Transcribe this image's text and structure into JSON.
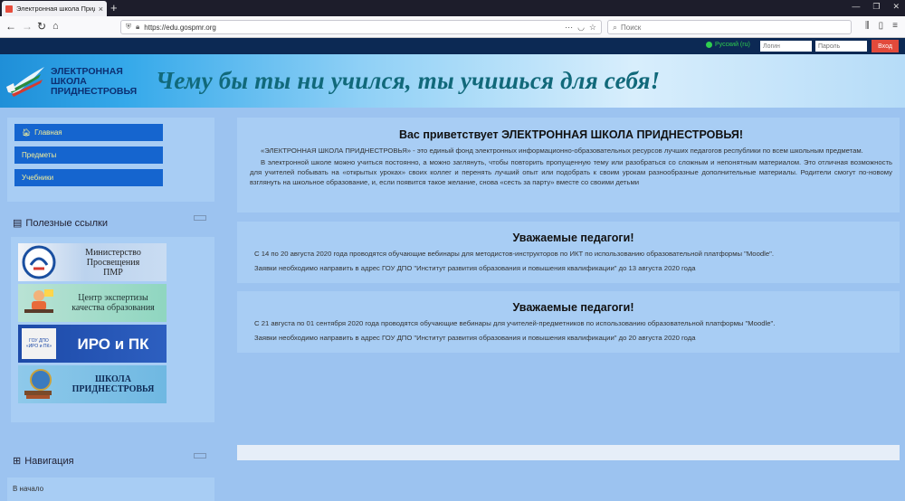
{
  "browser": {
    "tab_title": "Электронная школа Приднестровья",
    "tab_close": "×",
    "new_tab": "+",
    "window_controls": [
      "—",
      "❐",
      "✕"
    ],
    "url": "https://edu.gospmr.org",
    "search_placeholder": "Поиск"
  },
  "topbar": {
    "language": "Русский (ru)",
    "login_placeholder": "Логин",
    "password_placeholder": "Пароль",
    "login_button": "Вход"
  },
  "banner": {
    "logo_lines": [
      "ЭЛЕКТРОННАЯ",
      "ШКОЛА",
      "ПРИДНЕСТРОВЬЯ"
    ],
    "slogan": "Чему бы ты ни учился, ты учишься для себя!"
  },
  "menu": {
    "items": [
      {
        "label": "Главная",
        "icon": "home-icon"
      },
      {
        "label": "Предметы"
      },
      {
        "label": "Учебники"
      }
    ]
  },
  "useful_links": {
    "title": "Полезные ссылки",
    "items": [
      {
        "label_lines": [
          "Министерство",
          "Просвещения",
          "ПМР"
        ]
      },
      {
        "label_lines": [
          "Центр экспертизы",
          "качества образования"
        ]
      },
      {
        "label_lines": [
          "ИРО и ПК"
        ],
        "sub_lines": [
          "ГОУ ДПО",
          "«ИРО и ПК»"
        ]
      },
      {
        "label_lines": [
          "ШКОЛА",
          "ПРИДНЕСТРОВЬЯ"
        ]
      }
    ]
  },
  "navigation": {
    "title": "Навигация",
    "first_item": "В начало"
  },
  "welcome": {
    "title": "Вас приветствует ЭЛЕКТРОННАЯ ШКОЛА ПРИДНЕСТРОВЬЯ!",
    "p1": "«ЭЛЕКТРОННАЯ ШКОЛА ПРИДНЕСТРОВЬЯ» - это единый фонд электронных информационно-образовательных ресурсов лучших педагогов республики по всем школьным предметам.",
    "p2": "В электронной школе можно учиться постоянно, а можно заглянуть, чтобы повторить пропущенную тему или разобраться со сложным и непонятным материалом. Это отличная возможность для учителей побывать на «открытых уроках» своих коллег и перенять лучший опыт или подобрать к своим урокам разнообразные дополнительные материалы. Родители смогут по-новому взглянуть на школьное образование, и, если появится такое желание, снова «сесть за парту» вместе со своими детьми"
  },
  "notice1": {
    "title": "Уважаемые педагоги!",
    "p1": "С 14 по 20 августа 2020 года проводятся обучающие вебинары для методистов-инструкторов по ИКТ по использованию образовательной платформы \"Moodle\".",
    "p2": "Заявки необходимо направить в адрес ГОУ ДПО \"Институт развития образования и повышения квалификации\" до 13 августа 2020 года"
  },
  "notice2": {
    "title": "Уважаемые педагоги!",
    "p1": "С 21 августа по 01 сентября 2020 года проводятся обучающие вебинары для учителей-предметников  по использованию образовательной платформы \"Moodle\".",
    "p2": "Заявки необходимо направить в адрес ГОУ ДПО \"Институт развития образования и повышения квалификации\" до 20 августа 2020 года"
  },
  "colors": {
    "page_bg": "#9cc3f0",
    "block_bg": "#a8cdf4",
    "menu_button": "#1565cf",
    "menu_text": "#f4ef9a",
    "topbar": "#0c2954",
    "login_button": "#e24a3b"
  }
}
